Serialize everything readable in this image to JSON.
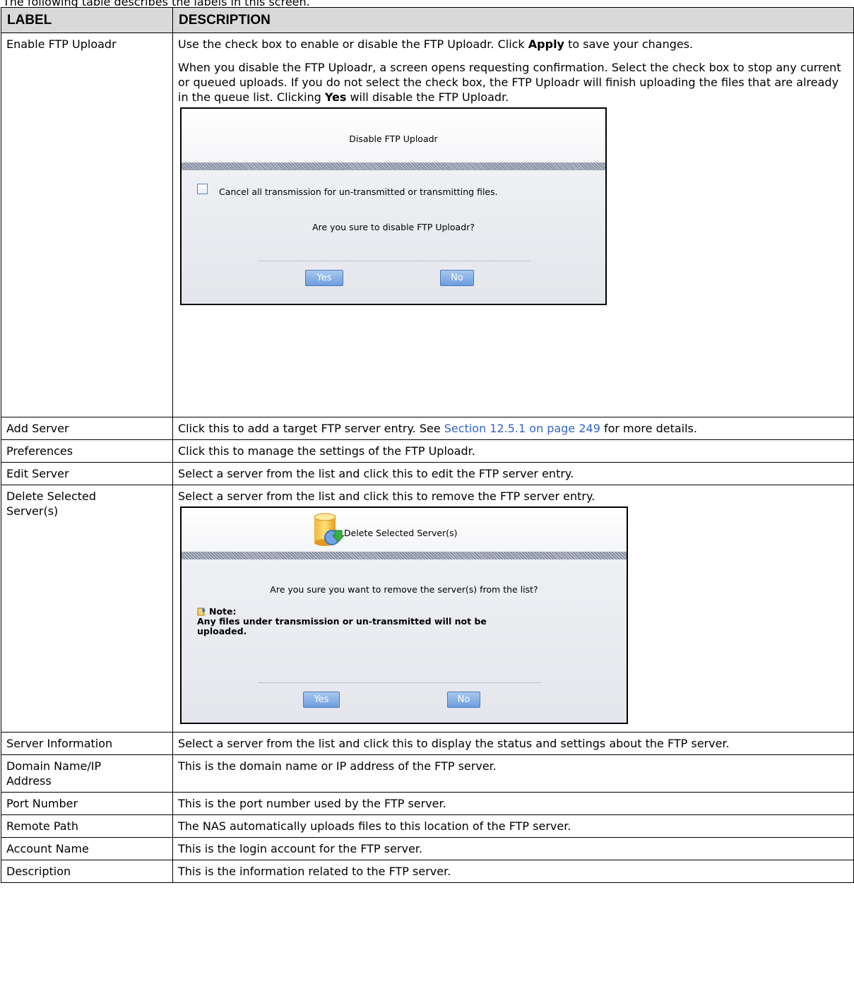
{
  "caption": "The following table describes the labels in this screen.",
  "table": {
    "headers": [
      "LABEL",
      "DESCRIPTION"
    ],
    "rows": [
      {
        "label": "Enable FTP Uploadr",
        "desc_1_pre": "Use the check box to enable or disable the FTP Uploadr. Click ",
        "desc_1_bold": "Apply",
        "desc_1_post": " to save your changes.",
        "desc_2_pre": "When you disable the FTP Uploadr, a screen opens requesting confirmation. Select the check box to stop any current or queued uploads. If you do not select the check box, the FTP Uploadr will finish uploading the files that are already in the queue list. Clicking ",
        "desc_2_bold": "Yes",
        "desc_2_post": " will disable the FTP Uploadr."
      },
      {
        "label": "Add Server",
        "desc_pre": "Click this to add a target FTP server entry. See ",
        "desc_link": "Section 12.5.1 on page 249",
        "desc_post": " for more details."
      },
      {
        "label": "Preferences",
        "desc": "Click this to manage the settings of the FTP Uploadr."
      },
      {
        "label": "Edit Server",
        "desc": "Select a server from the list and click this to edit the FTP server entry."
      },
      {
        "label": "Delete Selected Server(s)",
        "desc": "Select a server from the list and click this to remove the FTP server entry."
      },
      {
        "label": "Server Information",
        "desc": "Select a server from the list and click this to display the status and settings about the FTP server."
      },
      {
        "label": "Domain Name/IP Address",
        "desc": "This is the domain name or IP address of the FTP server."
      },
      {
        "label": "Port Number",
        "desc": "This is the port number used by the FTP server."
      },
      {
        "label": "Remote Path",
        "desc": "The NAS automatically uploads files to this location of the FTP server."
      },
      {
        "label": "Account Name",
        "desc": "This is the login account for the FTP server."
      },
      {
        "label": "Description",
        "desc": "This is the information related to the FTP server."
      }
    ]
  },
  "dialog_disable": {
    "title": "Disable FTP Uploadr",
    "checkbox_label": "Cancel all transmission for un-transmitted or transmitting files.",
    "checkbox_checked": false,
    "question": "Are you sure to disable FTP Uploadr?",
    "yes": "Yes",
    "no": "No"
  },
  "dialog_delete": {
    "title": "Delete Selected Server(s)",
    "icon": "server-delete-icon",
    "question": "Are you sure you want to remove the server(s) from the list?",
    "note_icon": "note-icon",
    "note_title": "Note:",
    "note_text": "Any files under transmission or un-transmitted will not be uploaded.",
    "yes": "Yes",
    "no": "No"
  },
  "colors": {
    "header_bg": "#d9d9d9",
    "link": "#3366cc",
    "button": "#7fa9e6"
  }
}
